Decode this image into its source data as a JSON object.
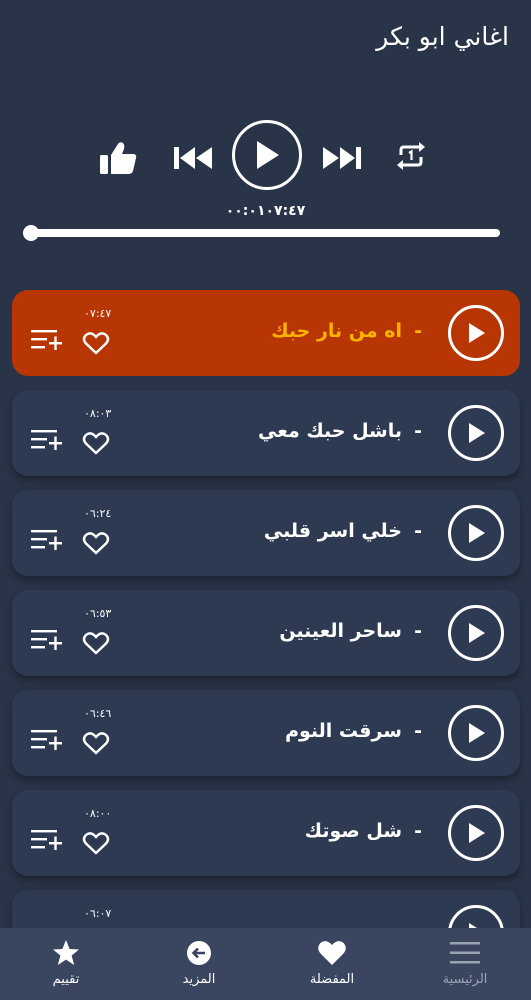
{
  "app": {
    "title": "اغاني ابو بكر"
  },
  "player": {
    "time_display": "٠٠:٠١٠٧:٤٧",
    "progress": 0.0,
    "icons": [
      "like-icon",
      "previous-icon",
      "play-icon",
      "next-icon",
      "repeat-one-icon"
    ]
  },
  "songs": [
    {
      "title": "اه من نار حبك",
      "dash": "-",
      "duration": "٠٧:٤٧",
      "active": true
    },
    {
      "title": "باشل حبك معي",
      "dash": "-",
      "duration": "٠٨:٠٣",
      "active": false
    },
    {
      "title": "خلي اسر قلبي",
      "dash": "-",
      "duration": "٠٦:٢٤",
      "active": false
    },
    {
      "title": "ساحر العينين",
      "dash": "-",
      "duration": "٠٦:٥٣",
      "active": false
    },
    {
      "title": "سرقت النوم",
      "dash": "-",
      "duration": "٠٦:٤٦",
      "active": false
    },
    {
      "title": "شل صوتك",
      "dash": "-",
      "duration": "٠٨:٠٠",
      "active": false
    },
    {
      "title": "",
      "dash": "-",
      "duration": "٠٦:٠٧",
      "active": false
    }
  ],
  "nav": {
    "home": "الرئيسية",
    "favorites": "المفضلة",
    "more": "المزيد",
    "rate": "تقييم"
  },
  "colors": {
    "background": "#2a3448",
    "row": "#2d3a52",
    "active_row": "#b83504",
    "active_title": "#ffb300",
    "nav_bar": "#3a4660"
  }
}
